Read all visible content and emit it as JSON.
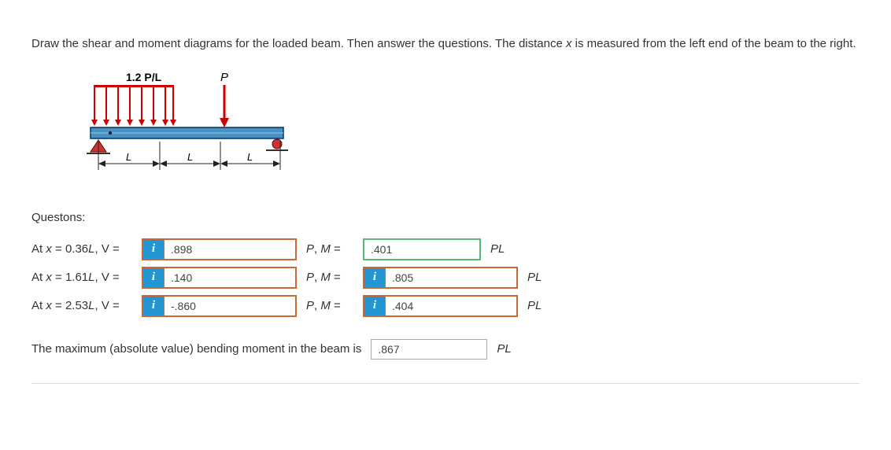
{
  "intro": {
    "line1": "Draw the shear and moment diagrams for the loaded beam. Then answer the questions. The distance ",
    "xvar": "x",
    "line2": " is measured from the left end of the beam to the right."
  },
  "figure": {
    "load_distributed": "1.2 P/L",
    "load_point": "P",
    "dim": "L"
  },
  "questions_label": "Questons:",
  "rows": [
    {
      "label_pre": "At ",
      "label_x": "x",
      "label_post": " = 0.36",
      "label_L": "L",
      "label_end": ", V =",
      "v": ".898",
      "mid": "P, M =",
      "m": ".401",
      "unit": "PL",
      "v_hasI": true,
      "m_hasI": false,
      "m_green": true
    },
    {
      "label_pre": "At ",
      "label_x": "x",
      "label_post": " = 1.61",
      "label_L": "L",
      "label_end": ", V =",
      "v": ".140",
      "mid": "P, M =",
      "m": ".805",
      "unit": "PL",
      "v_hasI": true,
      "m_hasI": true,
      "m_green": false
    },
    {
      "label_pre": "At ",
      "label_x": "x",
      "label_post": " = 2.53",
      "label_L": "L",
      "label_end": ", V =",
      "v": "-.860",
      "mid": "P, M =",
      "m": ".404",
      "unit": "PL",
      "v_hasI": true,
      "m_hasI": true,
      "m_green": false
    }
  ],
  "maxmoment": {
    "label": "The maximum (absolute value) bending moment in the beam is",
    "value": ".867",
    "unit": "PL"
  },
  "icon_label": "i"
}
